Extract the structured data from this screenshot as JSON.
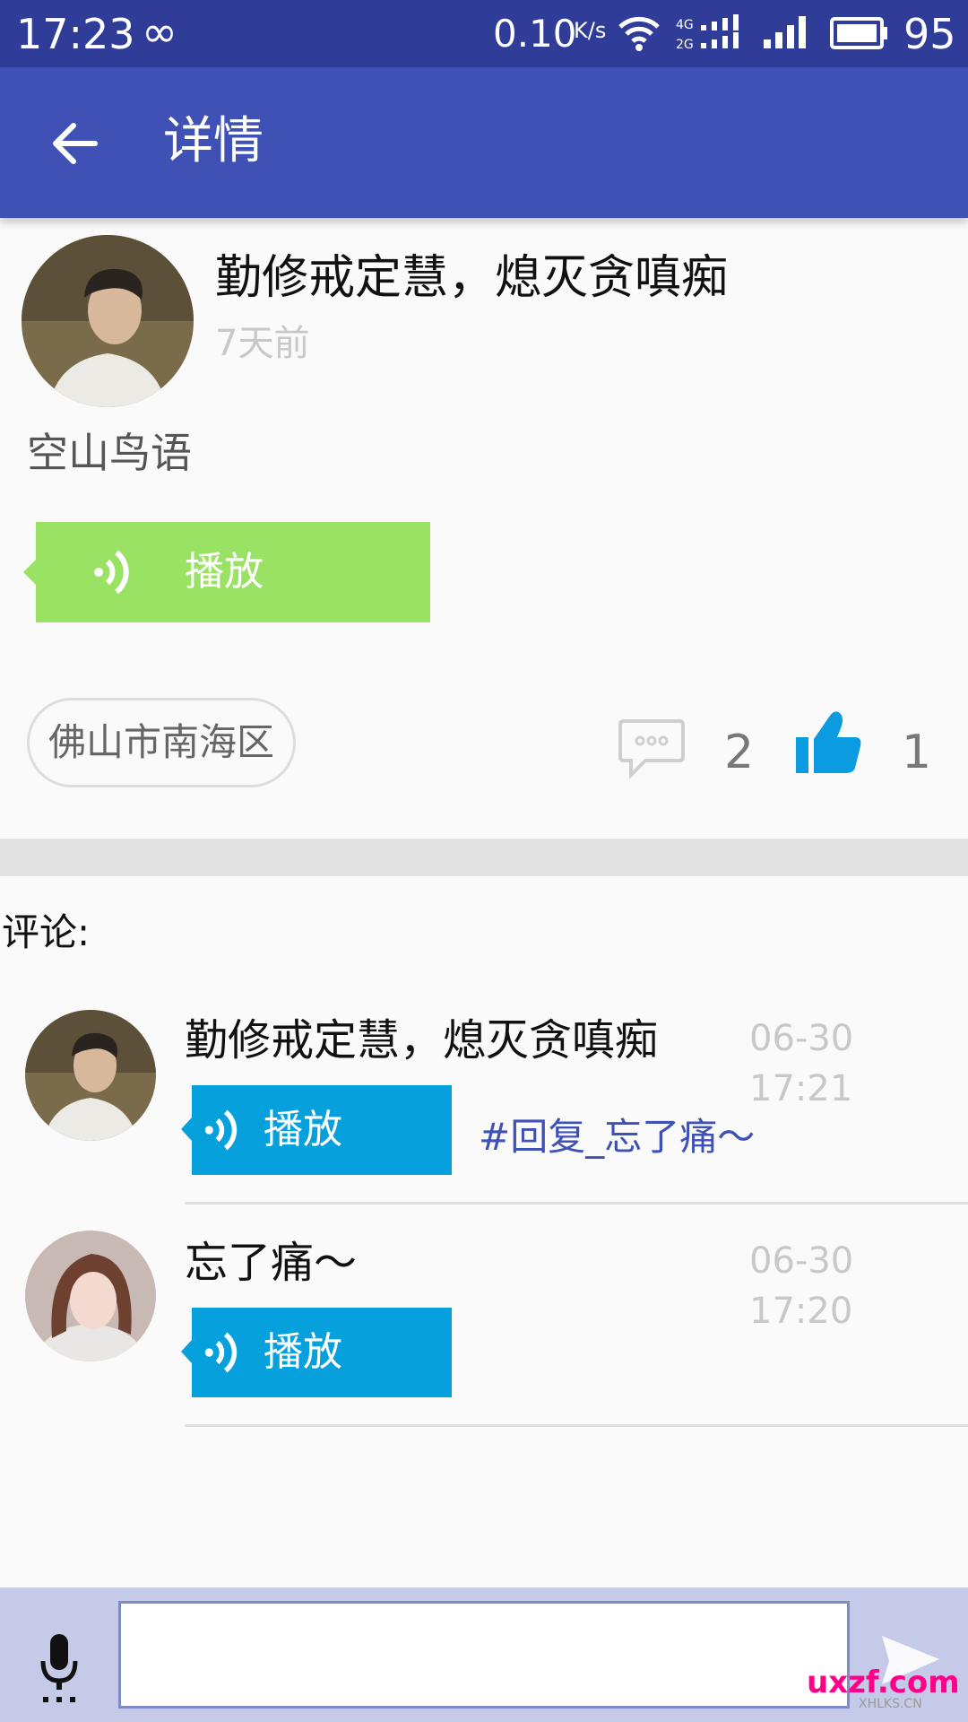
{
  "status_bar": {
    "time": "17:23",
    "infinity": "∞",
    "net_speed": "0.10",
    "net_unit": "K/s",
    "battery": "95"
  },
  "app_bar": {
    "title": "详情"
  },
  "post": {
    "author": "勤修戒定慧，熄灭贪嗔痴",
    "time_ago": "7天前",
    "text": "空山鸟语",
    "voice_label": "播放",
    "location": "佛山市南海区",
    "comment_count": "2",
    "like_count": "1"
  },
  "comments_heading": "评论:",
  "comments": [
    {
      "name": "勤修戒定慧，熄灭贪嗔痴",
      "time": "06-30 17:21",
      "voice_label": "播放",
      "reply": "#回复_忘了痛～"
    },
    {
      "name": "忘了痛～",
      "time": "06-30 17:20",
      "voice_label": "播放",
      "reply": ""
    }
  ],
  "watermark": {
    "logo": "uxzf.com",
    "sub": "XHLKS.CN"
  },
  "colors": {
    "status_bar": "#2f3d99",
    "app_bar": "#3f51b5",
    "voice_post": "#99e264",
    "voice_comment": "#06a0dc",
    "like_icon": "#0a9be0",
    "input_bar": "#c5cae9"
  }
}
